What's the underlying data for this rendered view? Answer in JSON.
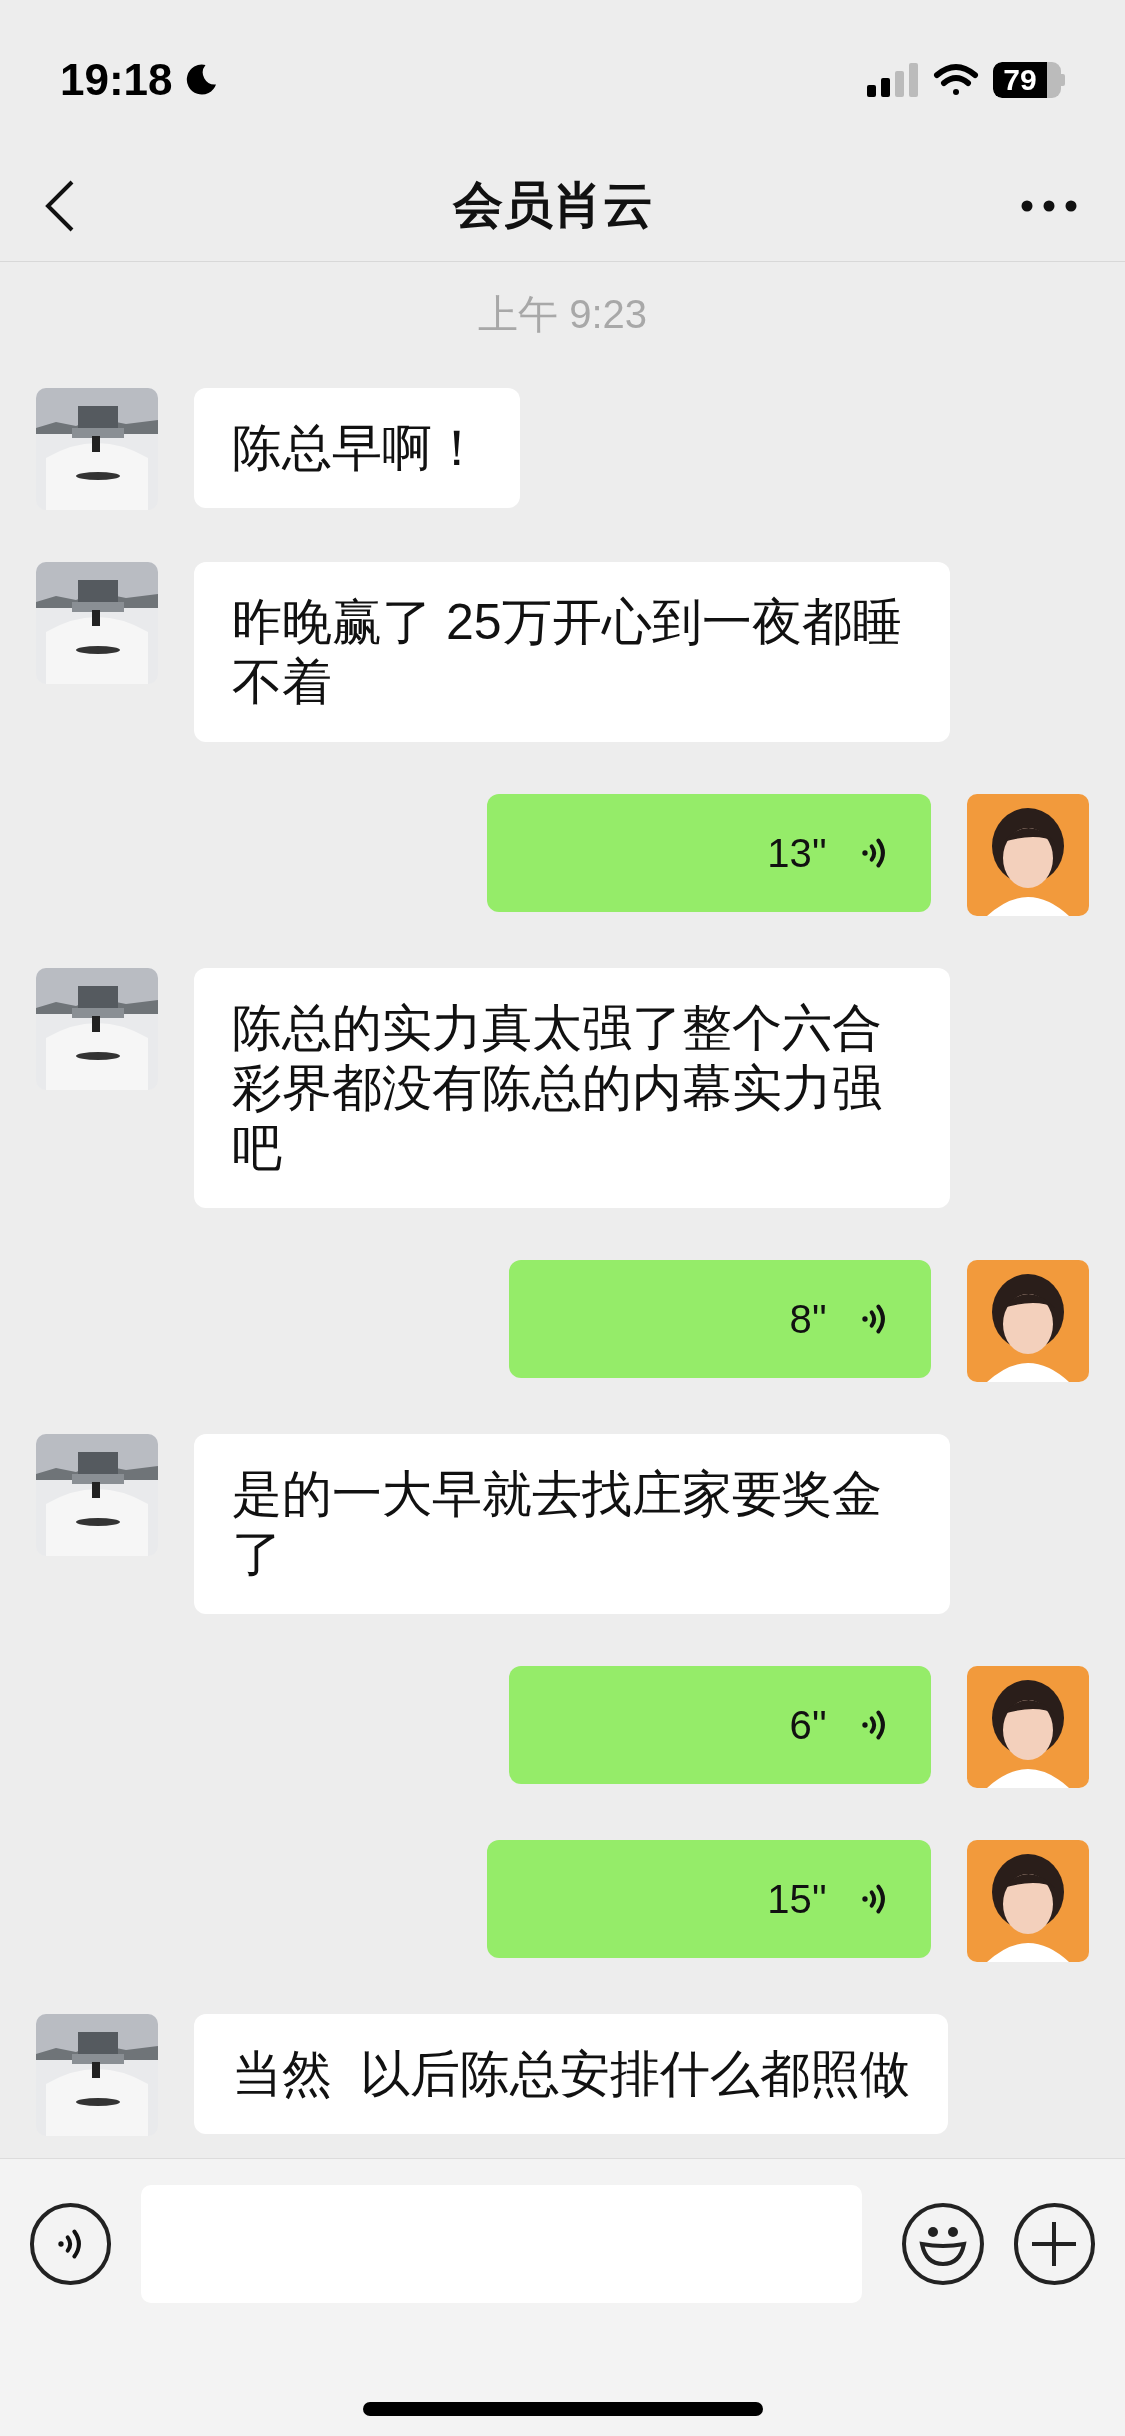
{
  "status_bar": {
    "time": "19:18",
    "battery": "79"
  },
  "header": {
    "title": "会员肖云"
  },
  "timestamp": "上午 9:23",
  "messages": [
    {
      "kind": "text",
      "outgoing": false,
      "text": "陈总早啊！"
    },
    {
      "kind": "text",
      "outgoing": false,
      "text": "昨晚赢了 25万开心到一夜都睡不着"
    },
    {
      "kind": "voice",
      "outgoing": true,
      "text": "13''"
    },
    {
      "kind": "text",
      "outgoing": false,
      "text": "陈总的实力真太强了整个六合彩界都没有陈总的内幕实力强吧"
    },
    {
      "kind": "voice",
      "outgoing": true,
      "text": "8''"
    },
    {
      "kind": "text",
      "outgoing": false,
      "text": "是的一大早就去找庄家要奖金了"
    },
    {
      "kind": "voice",
      "outgoing": true,
      "text": "6''"
    },
    {
      "kind": "voice",
      "outgoing": true,
      "text": "15''"
    },
    {
      "kind": "text",
      "outgoing": false,
      "text": "当然  以后陈总安排什么都照做"
    }
  ]
}
